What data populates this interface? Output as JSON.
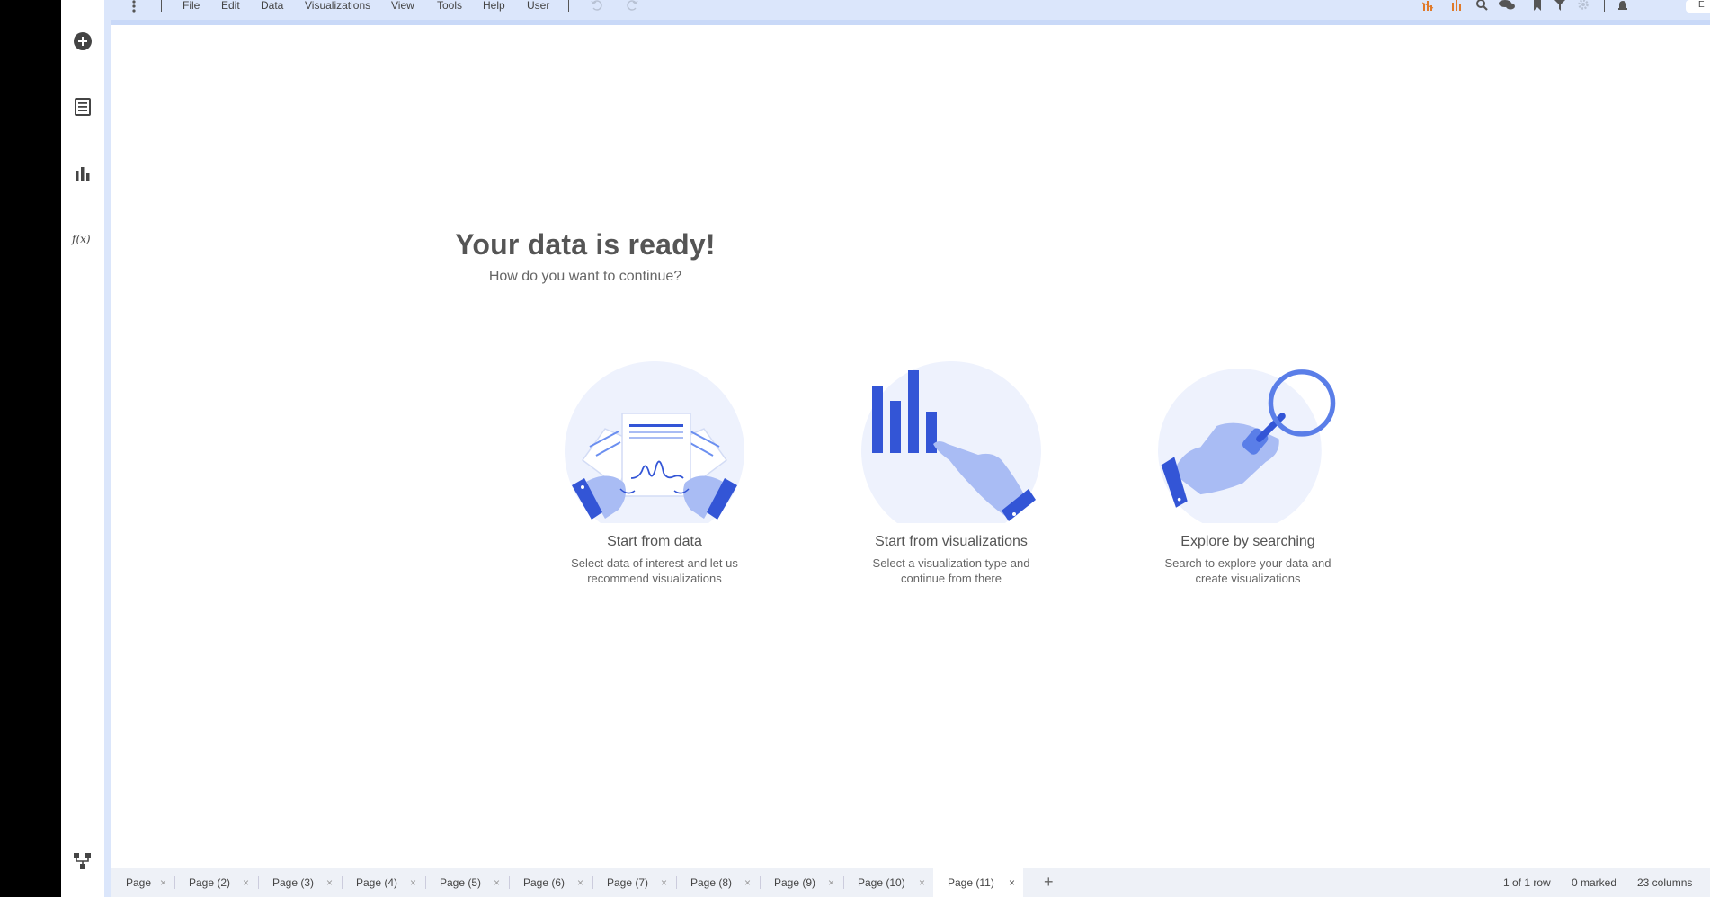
{
  "menu": {
    "items": [
      "File",
      "Edit",
      "Data",
      "Visualizations",
      "View",
      "Tools",
      "Help",
      "User"
    ]
  },
  "toolbar": {
    "user_initial": "E"
  },
  "welcome": {
    "title": "Your data is ready!",
    "subtitle": "How do you want to continue?",
    "options": [
      {
        "title": "Start from data",
        "desc_line1": "Select data of interest and let us",
        "desc_line2": "recommend visualizations"
      },
      {
        "title": "Start from visualizations",
        "desc_line1": "Select a visualization type and",
        "desc_line2": "continue from there"
      },
      {
        "title": "Explore by searching",
        "desc_line1": "Search to explore your data and",
        "desc_line2": "create visualizations"
      }
    ]
  },
  "pages": {
    "tabs": [
      "Page",
      "Page (2)",
      "Page (3)",
      "Page (4)",
      "Page (5)",
      "Page (6)",
      "Page (7)",
      "Page (8)",
      "Page (9)",
      "Page (10)",
      "Page (11)"
    ],
    "active_index": 10,
    "close_symbol": "×",
    "add_symbol": "+"
  },
  "status": {
    "rows": "1 of 1 row",
    "marked": "0 marked",
    "columns": "23 columns"
  },
  "colors": {
    "accent": "#3355d6",
    "frame": "#dbe6fb",
    "circle": "#eef2fd"
  }
}
